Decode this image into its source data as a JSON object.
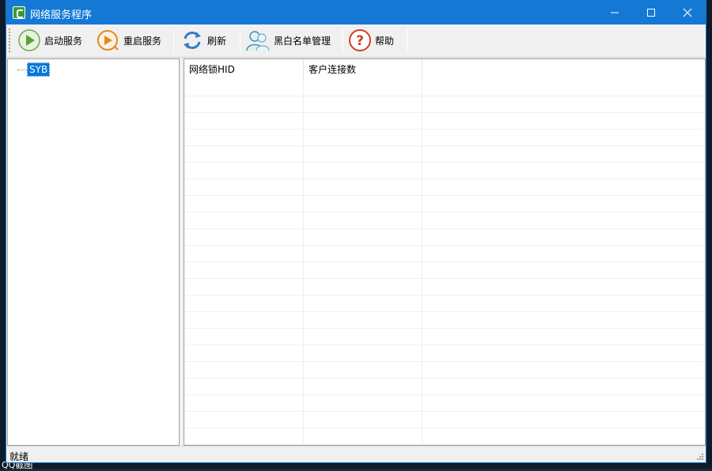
{
  "window": {
    "title": "网络服务程序"
  },
  "toolbar": {
    "start_label": "启动服务",
    "restart_label": "重启服务",
    "refresh_label": "刷新",
    "blacklist_label": "黑白名单管理",
    "help_label": "帮助"
  },
  "tree": {
    "root_label": "SYB"
  },
  "list": {
    "columns": [
      "网络锁HID",
      "客户连接数"
    ]
  },
  "status": {
    "text": "就绪"
  },
  "desktop": {
    "qq_label": "QQ截图"
  },
  "colors": {
    "titlebar": "#1479d4",
    "selection": "#0078d7"
  }
}
